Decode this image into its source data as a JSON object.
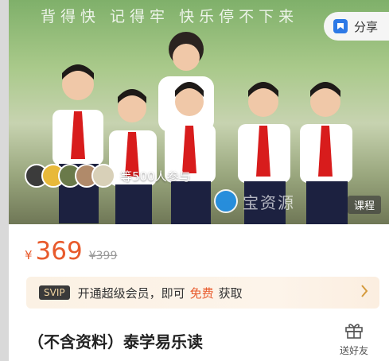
{
  "hero": {
    "slogan": "背得快 记得牢 快乐停不下来",
    "share_label": "分享",
    "participants_label": "等500人参与",
    "watermark_text": "宝资源",
    "course_badge": "课程"
  },
  "price": {
    "currency": "¥",
    "current": "369",
    "original": "¥399"
  },
  "svip": {
    "badge": "SVIP",
    "text": "开通超级会员，即可",
    "highlight": "免费",
    "suffix": "获取"
  },
  "course": {
    "title": "（不含资料）泰学易乐读"
  },
  "gift": {
    "label": "送好友"
  },
  "colors": {
    "accent": "#e85a2c",
    "svip_badge_bg": "#3a3a3a",
    "svip_badge_text": "#f0d3a0"
  }
}
